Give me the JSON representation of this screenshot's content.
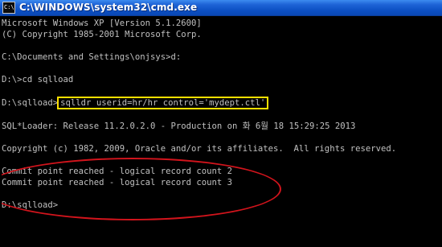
{
  "window": {
    "title": "C:\\WINDOWS\\system32\\cmd.exe",
    "icon": "cmd-icon",
    "icon_glyph": "C:\\"
  },
  "console": {
    "lines": [
      "Microsoft Windows XP [Version 5.1.2600]",
      "(C) Copyright 1985-2001 Microsoft Corp.",
      "C:\\Documents and Settings\\onjsys>d:",
      "D:\\>cd sqlload",
      "D:\\sqlload>",
      "sqlldr userid=hr/hr control='mydept.ctl'",
      "SQL*Loader: Release 11.2.0.2.0 - Production on 화 6월 18 15:29:25 2013",
      "Copyright (c) 1982, 2009, Oracle and/or its affiliates.  All rights reserved.",
      "Commit point reached - logical record count 2",
      "Commit point reached - logical record count 3",
      "D:\\sqlload>"
    ]
  },
  "annotations": {
    "highlight_color": "#ffe000",
    "circle_color": "#d2141c"
  },
  "colors": {
    "titlebar": "#0b4fc2",
    "console_bg": "#000000",
    "console_text": "#c0c0c0"
  }
}
